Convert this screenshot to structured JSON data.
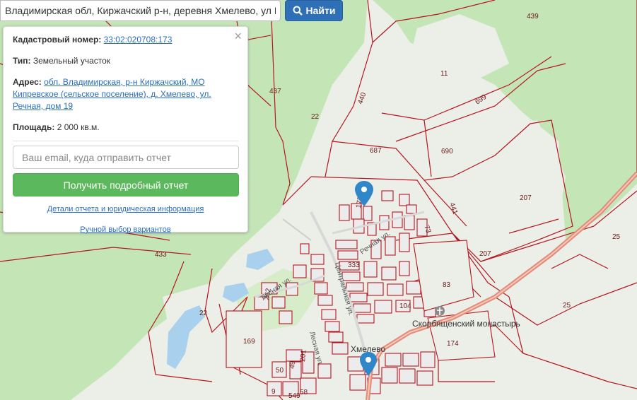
{
  "search": {
    "value": "Владимирская обл, Киржачский р-н, деревня Хмелево, ул Р",
    "button_label": "Найти"
  },
  "info": {
    "cadastral_label": "Кадастровый номер:",
    "cadastral_number": "33:02:020708:173",
    "type_label": "Тип:",
    "type_value": "Земельный участок",
    "address_label": "Адрес:",
    "address_line1": "обл. Владимирская, р-н Киржачский, МО",
    "address_line2": "Кипревское (сельское поселение), д. Хмелево, ул.",
    "address_line3": "Речная, дом 19",
    "area_label": "Площадь:",
    "area_value": "2 000 кв.м.",
    "close_symbol": "×"
  },
  "report": {
    "email_placeholder": "Ваш email, куда отправить отчет",
    "button_label": "Получить подробный отчет",
    "details_link": "Детали отчета и юридическая информация",
    "manual_link": "Ручной выбор вариантов"
  },
  "map": {
    "parcel_labels": [
      "439",
      "437",
      "11",
      "440",
      "699",
      "22",
      "687",
      "690",
      "441",
      "207",
      "173",
      "25",
      "433",
      "207",
      "333",
      "83",
      "104",
      "22",
      "169",
      "25",
      "174",
      "262",
      "50",
      "49",
      "201",
      "58",
      "549",
      "9",
      "73"
    ],
    "street_labels": [
      "Речная ул.",
      "Центральная ул.",
      "Лесная ул.",
      "Лесная ул."
    ],
    "place_labels": [
      "Хмелево",
      "Скорбященский монастырь"
    ],
    "colors": {
      "forest": "#c4e6b7",
      "open": "#eceee8",
      "water": "#a9d0ec",
      "parcel_border": "#b5161f",
      "road": "#e58a7a",
      "marker": "#2f86c9"
    }
  },
  "icons": {
    "search": "search-icon",
    "close": "close-icon",
    "marker": "map-marker-icon",
    "church": "cross-icon"
  }
}
